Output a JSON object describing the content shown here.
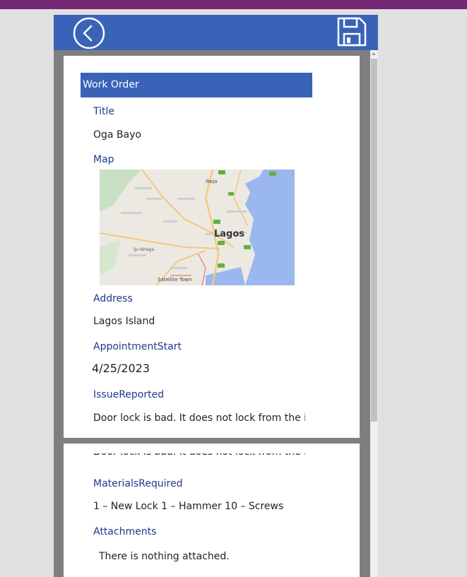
{
  "header": {
    "back_icon": "back-arrow-circle-icon",
    "save_icon": "floppy-disk-icon"
  },
  "form": {
    "section_title": "Work Order",
    "fields": {
      "title": {
        "label": "Title",
        "value": "Oga Bayo"
      },
      "map": {
        "label": "Map",
        "places": {
          "city": "Lagos",
          "north": "Ikeja",
          "west": "Iju Ishaga",
          "southwest": "Satellite Town"
        }
      },
      "address": {
        "label": "Address",
        "value": "Lagos Island"
      },
      "appointment_start": {
        "label": "AppointmentStart",
        "value": "4/25/2023"
      },
      "issue_reported": {
        "label": "IssueReported",
        "value": "Door lock is bad. It does not lock from the in"
      },
      "materials_required": {
        "label": "MaterialsRequired",
        "value": "1 – New Lock  1 – Hammer  10 – Screws"
      },
      "attachments": {
        "label": "Attachments",
        "value": "There is nothing attached."
      }
    }
  },
  "colors": {
    "top_bar": "#742775",
    "header": "#3a63b8",
    "label_text": "#1e3a8a",
    "map_water": "#9ab8ee"
  }
}
